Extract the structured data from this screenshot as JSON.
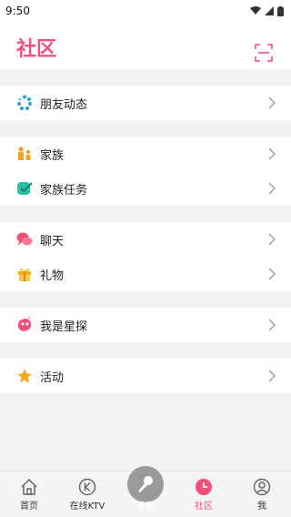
{
  "status": {
    "time": "9:50"
  },
  "header": {
    "title": "社区"
  },
  "sections": [
    {
      "items": [
        {
          "label": "朋友动态",
          "icon": "friends-feed-icon"
        }
      ]
    },
    {
      "items": [
        {
          "label": "家族",
          "icon": "family-icon"
        },
        {
          "label": "家族任务",
          "icon": "family-task-icon"
        }
      ]
    },
    {
      "items": [
        {
          "label": "聊天",
          "icon": "chat-icon"
        },
        {
          "label": "礼物",
          "icon": "gift-icon"
        }
      ]
    },
    {
      "items": [
        {
          "label": "我是星探",
          "icon": "talent-scout-icon"
        }
      ]
    },
    {
      "items": [
        {
          "label": "活动",
          "icon": "star-icon"
        }
      ]
    }
  ],
  "tabs": [
    {
      "label": "首页",
      "icon": "home-icon"
    },
    {
      "label": "在线KTV",
      "icon": "ktv-icon"
    },
    {
      "label": "录歌",
      "icon": "microphone-icon"
    },
    {
      "label": "社区",
      "icon": "community-icon",
      "active": true
    },
    {
      "label": "我",
      "icon": "profile-icon"
    }
  ],
  "colors": {
    "accent": "#f0507a"
  }
}
